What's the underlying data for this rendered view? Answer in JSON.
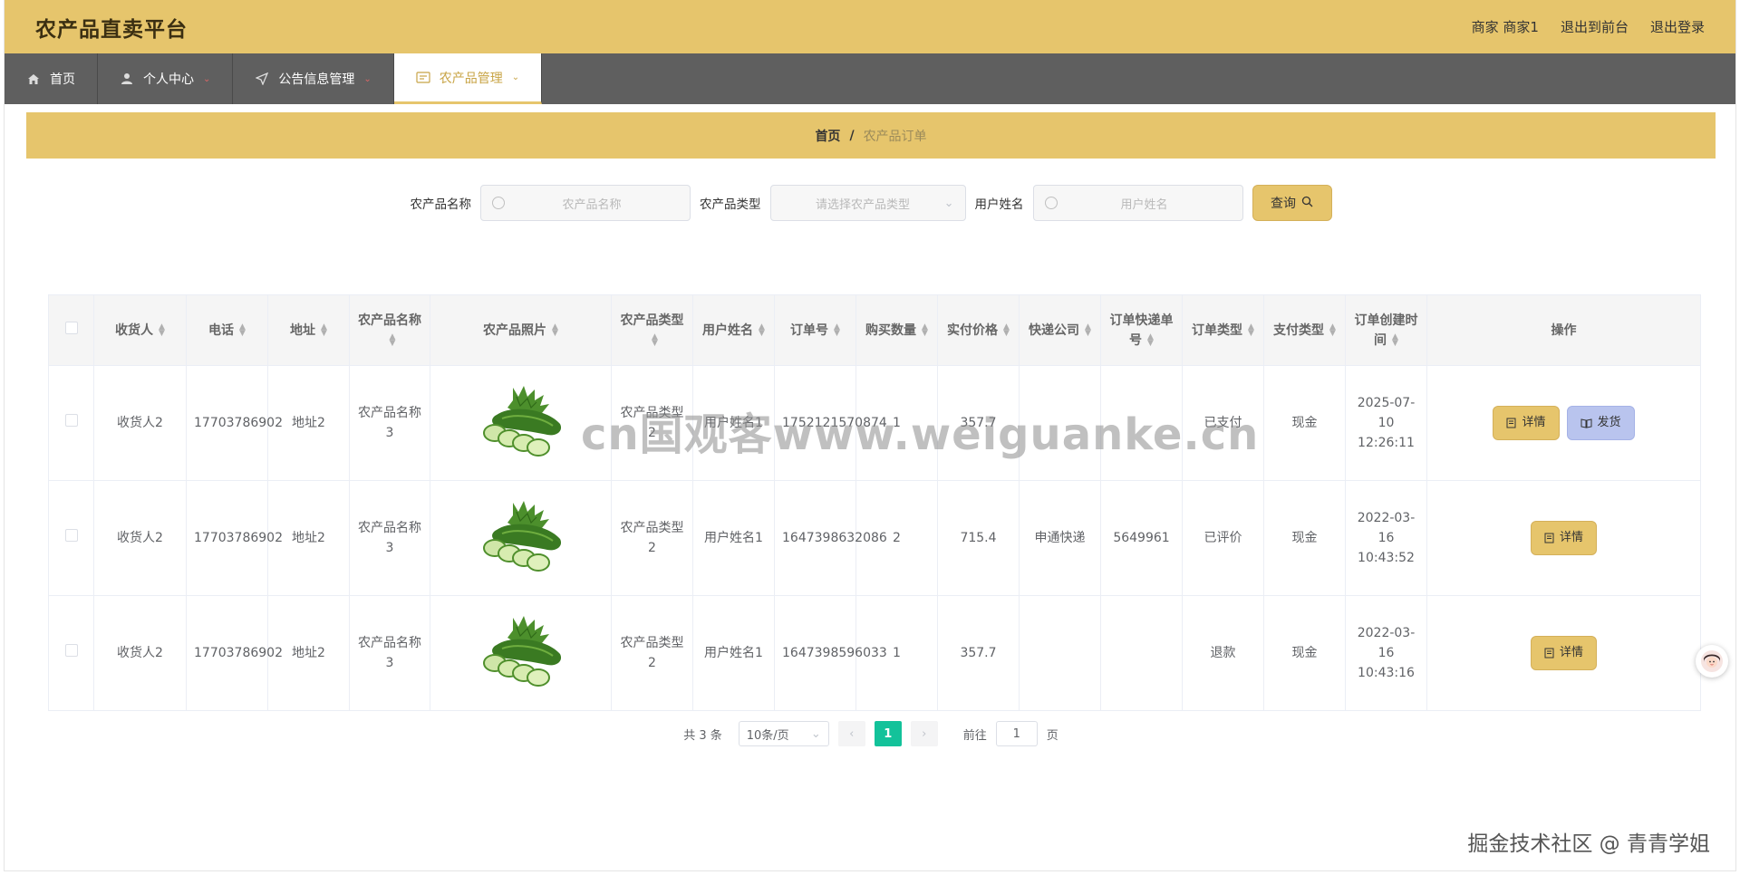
{
  "header": {
    "title": "农产品直卖平台",
    "user_label": "商家 商家1",
    "front_label": "退出到前台",
    "logout_label": "退出登录"
  },
  "nav": {
    "items": [
      {
        "label": "首页",
        "icon": "home-icon"
      },
      {
        "label": "个人中心",
        "icon": "user-icon"
      },
      {
        "label": "公告信息管理",
        "icon": "send-icon"
      },
      {
        "label": "农产品管理",
        "icon": "card-icon",
        "active": true
      }
    ]
  },
  "breadcrumb": {
    "home": "首页",
    "separator": "/",
    "current": "农产品订单"
  },
  "search": {
    "name_label": "农产品名称",
    "name_placeholder": "农产品名称",
    "type_label": "农产品类型",
    "type_placeholder": "请选择农产品类型",
    "user_label": "用户姓名",
    "user_placeholder": "用户姓名",
    "query_label": "查询"
  },
  "table": {
    "headers": [
      "收货人",
      "电话",
      "地址",
      "农产品名称",
      "农产品照片",
      "农产品类型",
      "用户姓名",
      "订单号",
      "购买数量",
      "实付价格",
      "快递公司",
      "订单快递单号",
      "订单类型",
      "支付类型",
      "订单创建时间",
      "操作"
    ],
    "rows": [
      {
        "receiver": "收货人2",
        "phone": "17703786902",
        "address": "地址2",
        "product": "农产品名称3",
        "type": "农产品类型2",
        "user": "用户姓名1",
        "order_no": "1752121570874",
        "qty": "1",
        "price": "357.7",
        "courier": "",
        "tracking": "",
        "order_type": "已支付",
        "pay_type": "现金",
        "created": "2025-07-10 12:26:11",
        "actions": [
          "详情",
          "发货"
        ]
      },
      {
        "receiver": "收货人2",
        "phone": "17703786902",
        "address": "地址2",
        "product": "农产品名称3",
        "type": "农产品类型2",
        "user": "用户姓名1",
        "order_no": "1647398632086",
        "qty": "2",
        "price": "715.4",
        "courier": "申通快递",
        "tracking": "5649961",
        "order_type": "已评价",
        "pay_type": "现金",
        "created": "2022-03-16 10:43:52",
        "actions": [
          "详情"
        ]
      },
      {
        "receiver": "收货人2",
        "phone": "17703786902",
        "address": "地址2",
        "product": "农产品名称3",
        "type": "农产品类型2",
        "user": "用户姓名1",
        "order_no": "1647398596033",
        "qty": "1",
        "price": "357.7",
        "courier": "",
        "tracking": "",
        "order_type": "退款",
        "pay_type": "现金",
        "created": "2022-03-16 10:43:16",
        "actions": [
          "详情"
        ]
      }
    ]
  },
  "pagination": {
    "total": "共 3 条",
    "page_size": "10条/页",
    "current_page": "1",
    "goto_label": "前往",
    "goto_value": "1",
    "page_suffix": "页"
  },
  "watermark": "cn国观客www.weiguanke.cn",
  "credit": "掘金技术社区 @ 青青学姐",
  "colors": {
    "accent": "#e6c56c",
    "nav_bg": "#5f5f5f",
    "page_active": "#13c29a",
    "ship_button": "#b9c4ee"
  }
}
